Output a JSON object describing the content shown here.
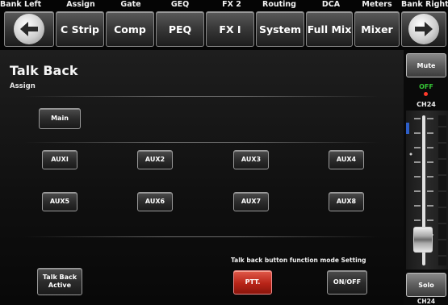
{
  "top_nav": {
    "labels": [
      "Bank Left",
      "Assign",
      "Gate",
      "GEQ",
      "FX 2",
      "Routing",
      "DCA",
      "Meters",
      "Bank Right"
    ],
    "buttons": [
      "C Strip",
      "Comp",
      "PEQ",
      "FX I",
      "System",
      "Full Mix",
      "Mixer"
    ]
  },
  "page": {
    "title": "Talk Back",
    "subtitle": "Assign"
  },
  "assign": {
    "main_label": "Main",
    "aux_row1": [
      "AUXI",
      "AUX2",
      "AUX3",
      "AUX4"
    ],
    "aux_row2": [
      "AUX5",
      "AUX6",
      "AUX7",
      "AUX8"
    ]
  },
  "talkback": {
    "active_label_line1": "Talk Back",
    "active_label_line2": "Active",
    "mode_heading": "Talk back button function mode Setting",
    "ptt_label": "PTT.",
    "onoff_label": "ON/OFF"
  },
  "channel_strip": {
    "mute_label": "Mute",
    "status": "OFF",
    "channel_top": "CH24",
    "solo_label": "Solo",
    "channel_bottom": "CH24",
    "fader_level": 0.12
  },
  "colors": {
    "ptt_active": "#b82418",
    "status_off": "#35c635"
  }
}
